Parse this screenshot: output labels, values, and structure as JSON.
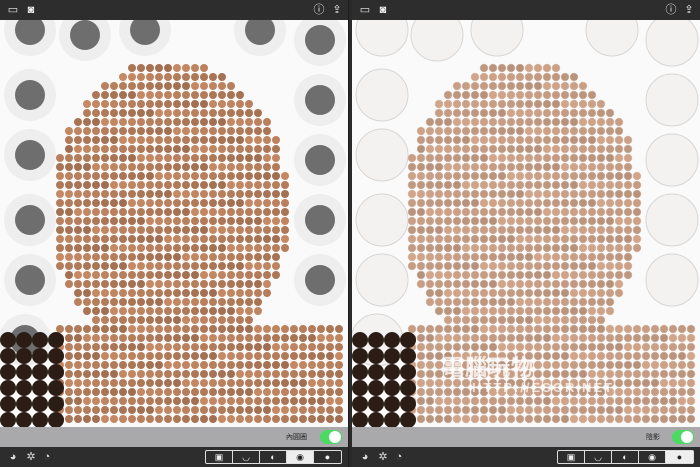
{
  "left_pane": {
    "option_label": "內圓圈",
    "option_on": true,
    "segments": [
      "▣",
      "◡",
      "◐",
      "◉",
      "●"
    ],
    "active_segment_index": 3
  },
  "right_pane": {
    "option_label": "陰影",
    "option_on": true,
    "segments": [
      "▣",
      "◡",
      "◐",
      "◉",
      "●"
    ],
    "active_segment_index": 4,
    "watermark_line1": "電腦玩物",
    "watermark_line2": "HTTP://ESOR.NET"
  },
  "icons": {
    "folder": "folder-icon",
    "camera": "camera-icon",
    "info": "info-icon",
    "share": "share-icon",
    "shapes": "shapes-icon",
    "settings": "gear-icon",
    "palette": "palette-icon"
  },
  "colors": {
    "toggle_on": "#4cd964",
    "bar_dark": "#2d2d2d",
    "option_bar": "#a9a9ab"
  }
}
